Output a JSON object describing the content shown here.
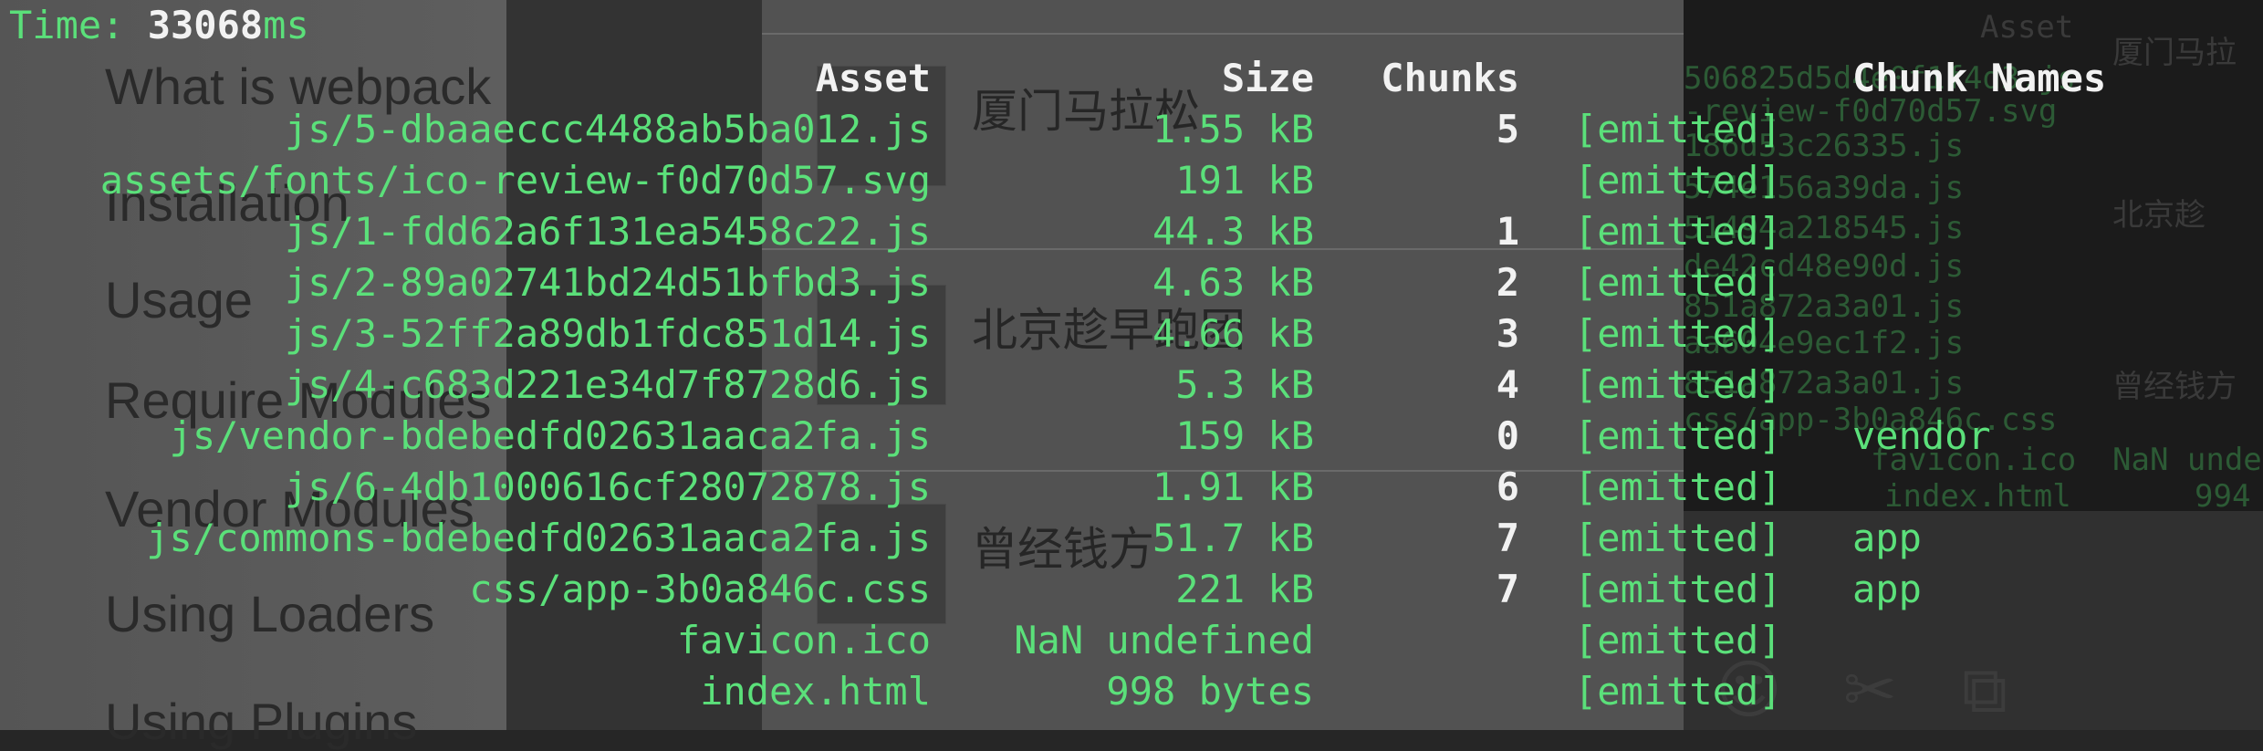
{
  "background": {
    "nav_items": [
      "What is webpack",
      "Installation",
      "Usage",
      "Require Modules",
      "Vendor Modules",
      "Using Loaders",
      "Using Plugins"
    ],
    "card_titles": [
      "厦门马拉松",
      "北京趁早跑团",
      "曾经钱方"
    ],
    "right_panel_header": "Asset",
    "right_panel_header_cn": "厦门马拉",
    "right_panel_lines": [
      "506825d5d4e0f1f4d3.js",
      "-review-f0d70d57.svg",
      "186d53c26335.js",
      "574e156a39da.js",
      "51494a218545.js",
      "de42cd48e90d.js",
      "851a872a3a01.js",
      "aa604e9ec1f2.js",
      "851a872a3a01.js",
      "css/app-3b0a846c.css",
      "favicon.ico",
      "index.html"
    ],
    "right_panel_cn": [
      "北京趁",
      "曾经钱方"
    ],
    "right_panel_nan": "NaN unde",
    "right_panel_num": "994"
  },
  "terminal": {
    "time_label": "Time:",
    "time_value": "33068",
    "time_unit": "ms",
    "headers": {
      "asset": "Asset",
      "size": "Size",
      "chunks": "Chunks",
      "chunk_names": "Chunk Names"
    },
    "rows": [
      {
        "asset": "js/5-dbaaeccc4488ab5ba012.js",
        "size": "1.55 kB",
        "chunks": "5",
        "status": "[emitted]",
        "name": ""
      },
      {
        "asset": "assets/fonts/ico-review-f0d70d57.svg",
        "size": "191 kB",
        "chunks": "",
        "status": "[emitted]",
        "name": ""
      },
      {
        "asset": "js/1-fdd62a6f131ea5458c22.js",
        "size": "44.3 kB",
        "chunks": "1",
        "status": "[emitted]",
        "name": ""
      },
      {
        "asset": "js/2-89a02741bd24d51bfbd3.js",
        "size": "4.63 kB",
        "chunks": "2",
        "status": "[emitted]",
        "name": ""
      },
      {
        "asset": "js/3-52ff2a89db1fdc851d14.js",
        "size": "4.66 kB",
        "chunks": "3",
        "status": "[emitted]",
        "name": ""
      },
      {
        "asset": "js/4-c683d221e34d7f8728d6.js",
        "size": "5.3 kB",
        "chunks": "4",
        "status": "[emitted]",
        "name": ""
      },
      {
        "asset": "js/vendor-bdebedfd02631aaca2fa.js",
        "size": "159 kB",
        "chunks": "0",
        "status": "[emitted]",
        "name": "vendor"
      },
      {
        "asset": "js/6-4db1000616cf28072878.js",
        "size": "1.91 kB",
        "chunks": "6",
        "status": "[emitted]",
        "name": ""
      },
      {
        "asset": "js/commons-bdebedfd02631aaca2fa.js",
        "size": "51.7 kB",
        "chunks": "7",
        "status": "[emitted]",
        "name": "app"
      },
      {
        "asset": "css/app-3b0a846c.css",
        "size": "221 kB",
        "chunks": "7",
        "status": "[emitted]",
        "name": "app"
      },
      {
        "asset": "favicon.ico",
        "size": "NaN undefined",
        "chunks": "",
        "status": "[emitted]",
        "name": ""
      },
      {
        "asset": "index.html",
        "size": "998 bytes",
        "chunks": "",
        "status": "[emitted]",
        "name": ""
      }
    ]
  },
  "colors": {
    "green": "#5be07a",
    "white": "#f2f2f2",
    "terminal_bg": "#262626"
  },
  "icons": [
    "scissors-icon",
    "copy-icon",
    "emoji-icon"
  ]
}
